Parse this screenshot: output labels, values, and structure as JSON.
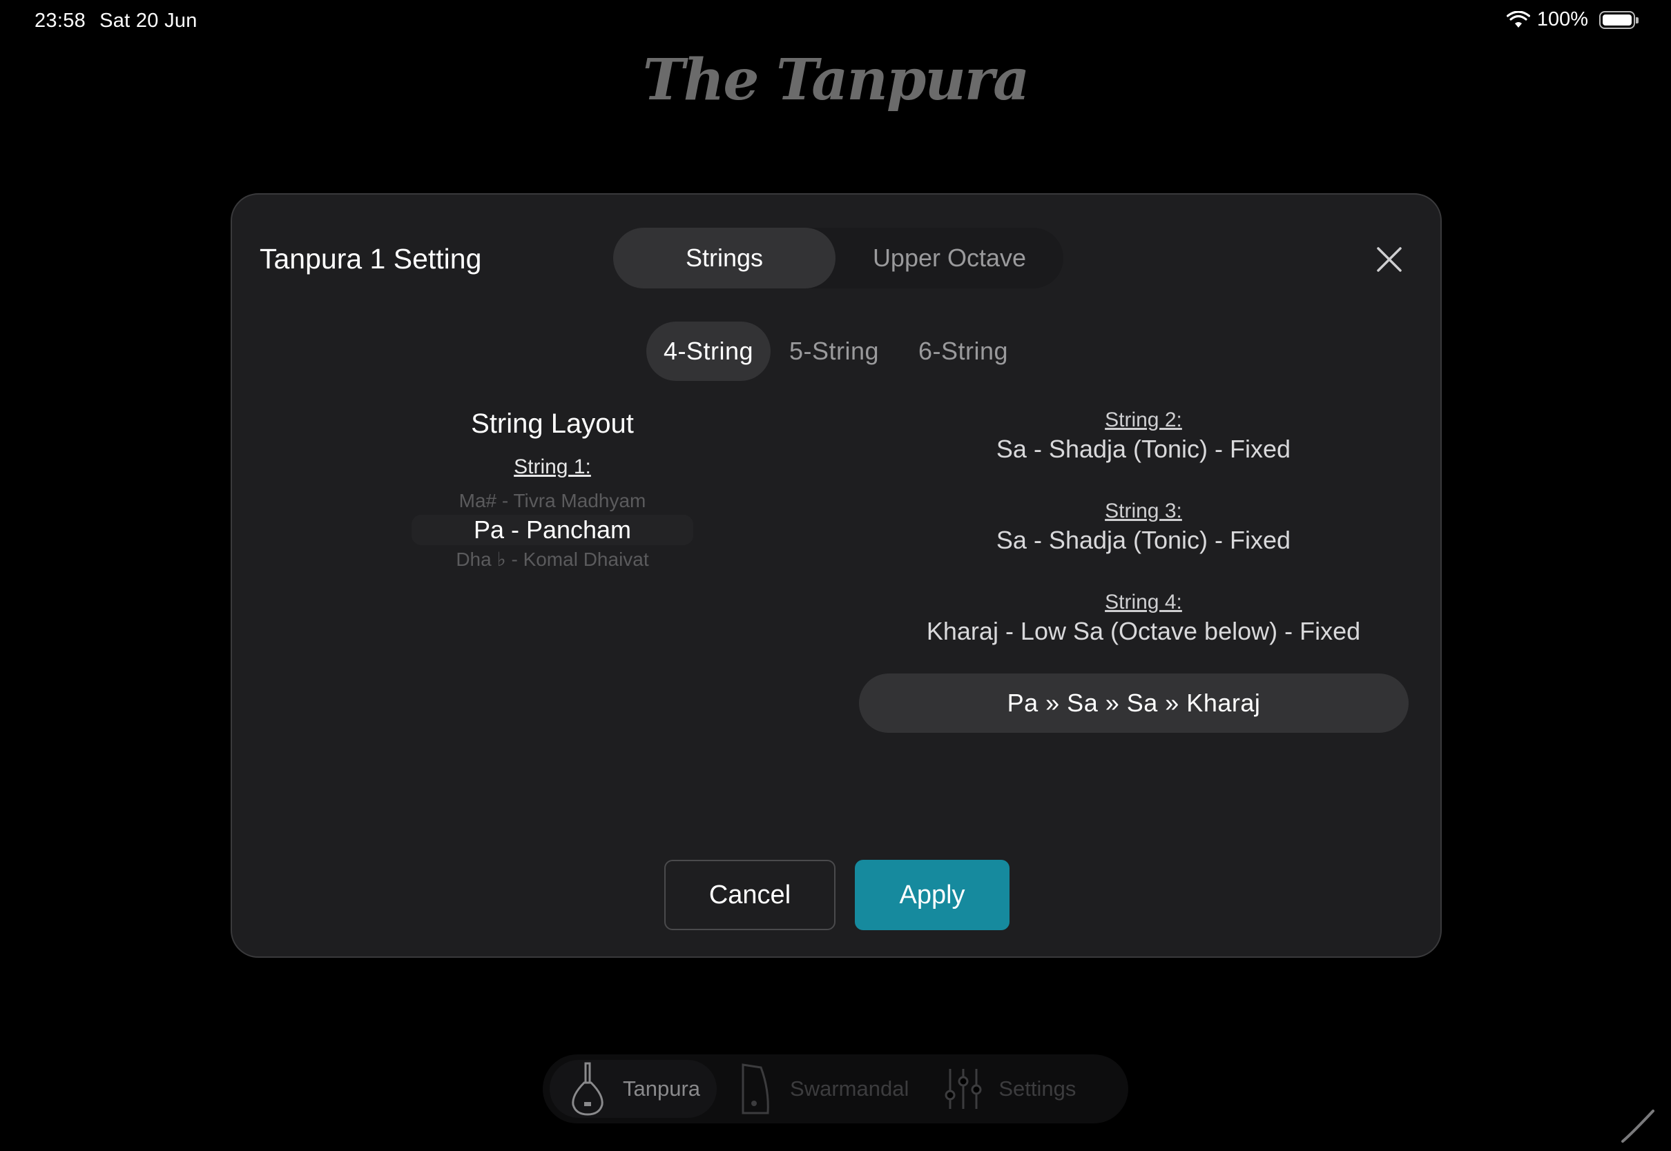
{
  "status_bar": {
    "time": "23:58",
    "date": "Sat 20 Jun",
    "battery": "100%"
  },
  "app": {
    "logo": "The Tanpura"
  },
  "modal": {
    "title": "Tanpura 1 Setting",
    "tabs": {
      "strings": "Strings",
      "upper_octave": "Upper Octave"
    },
    "string_count_tabs": {
      "four": "4-String",
      "five": "5-String",
      "six": "6-String"
    },
    "layout_heading": "String Layout",
    "string1": {
      "label": "String 1:",
      "picker_above": "Ma# - Tivra Madhyam",
      "picker_selected": "Pa - Pancham",
      "picker_below": "Dha ♭ - Komal Dhaivat"
    },
    "string2": {
      "label": "String 2:",
      "value": "Sa - Shadja (Tonic) - Fixed"
    },
    "string3": {
      "label": "String 3:",
      "value": "Sa - Shadja (Tonic) - Fixed"
    },
    "string4": {
      "label": "String 4:",
      "value": "Kharaj - Low Sa (Octave below) - Fixed"
    },
    "sequence": "Pa » Sa » Sa » Kharaj",
    "cancel_label": "Cancel",
    "apply_label": "Apply"
  },
  "tabbar": {
    "tanpura": "Tanpura",
    "swarmandal": "Swarmandal",
    "settings": "Settings"
  },
  "colors": {
    "accent": "#168a9e",
    "modal_bg": "#1e1e20",
    "background": "#000000"
  }
}
